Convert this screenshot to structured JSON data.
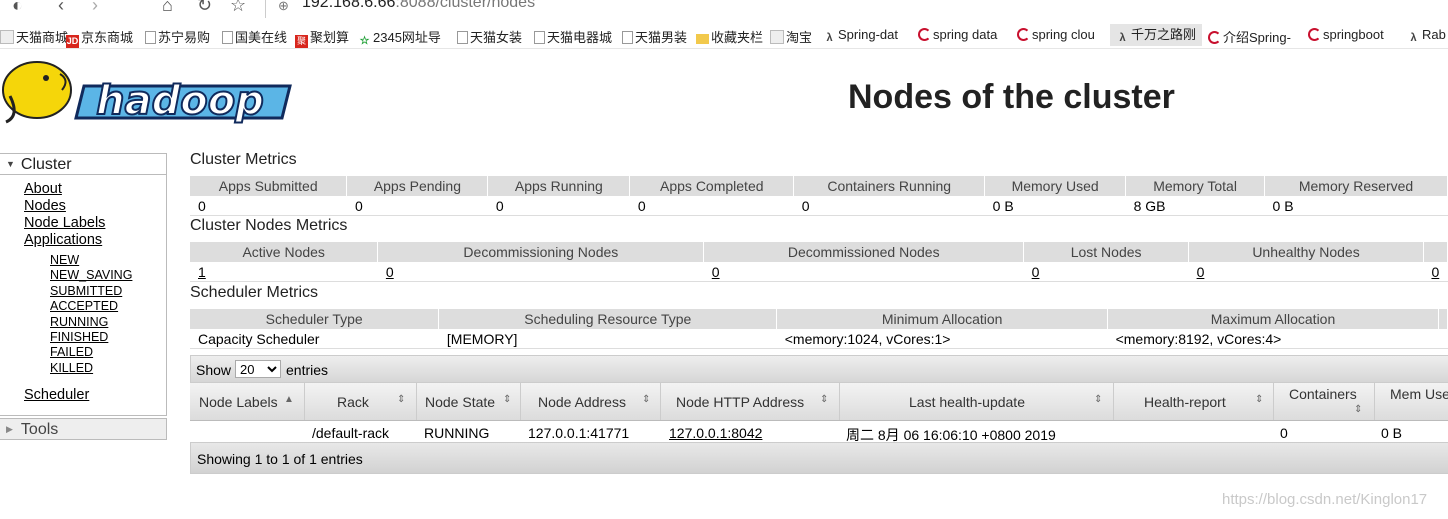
{
  "browser": {
    "url_host": "192.168.6.66",
    "url_rest": ":8088/cluster/nodes",
    "bookmarks": [
      {
        "icon": "tb",
        "label": "天猫商城"
      },
      {
        "icon": "jd",
        "label": "京东商城"
      },
      {
        "icon": "doc",
        "label": "苏宁易购"
      },
      {
        "icon": "doc",
        "label": "国美在线"
      },
      {
        "icon": "jh",
        "label": "聚划算"
      },
      {
        "icon": "g2345",
        "label": "2345网址导"
      },
      {
        "icon": "doc",
        "label": "天猫女装"
      },
      {
        "icon": "doc",
        "label": "天猫电器城"
      },
      {
        "icon": "doc",
        "label": "天猫男装"
      },
      {
        "icon": "folder",
        "label": "收藏夹栏"
      },
      {
        "icon": "tb",
        "label": "淘宝"
      },
      {
        "icon": "lam",
        "label": "Spring-dat"
      },
      {
        "icon": "csdn",
        "label": "spring data"
      },
      {
        "icon": "csdn",
        "label": "spring clou"
      },
      {
        "icon": "lam",
        "label": "千万之路刚"
      },
      {
        "icon": "csdn",
        "label": "介绍Spring-"
      },
      {
        "icon": "csdn",
        "label": "springboot"
      },
      {
        "icon": "lam",
        "label": "Rab"
      }
    ]
  },
  "header": {
    "title": "Nodes of the cluster",
    "logo_text": "hadoop"
  },
  "nav": {
    "cluster_label": "Cluster",
    "links": [
      "About",
      "Nodes",
      "Node Labels",
      "Applications"
    ],
    "app_states": [
      "NEW",
      "NEW_SAVING",
      "SUBMITTED",
      "ACCEPTED",
      "RUNNING",
      "FINISHED",
      "FAILED",
      "KILLED"
    ],
    "scheduler": "Scheduler",
    "tools_label": "Tools"
  },
  "cluster_metrics": {
    "title": "Cluster Metrics",
    "headers": [
      "Apps Submitted",
      "Apps Pending",
      "Apps Running",
      "Apps Completed",
      "Containers Running",
      "Memory Used",
      "Memory Total",
      "Memory Reserved"
    ],
    "values": [
      "0",
      "0",
      "0",
      "0",
      "0",
      "0 B",
      "8 GB",
      "0 B"
    ]
  },
  "node_metrics": {
    "title": "Cluster Nodes Metrics",
    "headers": [
      "Active Nodes",
      "Decommissioning Nodes",
      "Decommissioned Nodes",
      "Lost Nodes",
      "Unhealthy Nodes"
    ],
    "values": [
      "1",
      "0",
      "0",
      "0",
      "0",
      "0"
    ]
  },
  "scheduler_metrics": {
    "title": "Scheduler Metrics",
    "headers": [
      "Scheduler Type",
      "Scheduling Resource Type",
      "Minimum Allocation",
      "Maximum Allocation"
    ],
    "values": [
      "Capacity Scheduler",
      "[MEMORY]",
      "<memory:1024, vCores:1>",
      "<memory:8192, vCores:4>"
    ]
  },
  "nodes_table": {
    "show_label": "Show",
    "entries_label": "entries",
    "page_size": "20",
    "headers": [
      "Node Labels",
      "Rack",
      "Node State",
      "Node Address",
      "Node HTTP Address",
      "Last health-update",
      "Health-report",
      "Containers",
      "Mem Use"
    ],
    "row": [
      "",
      "/default-rack",
      "RUNNING",
      "127.0.0.1:41771",
      "127.0.0.1:8042",
      "周二 8月 06 16:06:10 +0800 2019",
      "",
      "0",
      "0 B"
    ],
    "footer": "Showing 1 to 1 of 1 entries"
  },
  "watermark": "https://blog.csdn.net/Kinglon17"
}
